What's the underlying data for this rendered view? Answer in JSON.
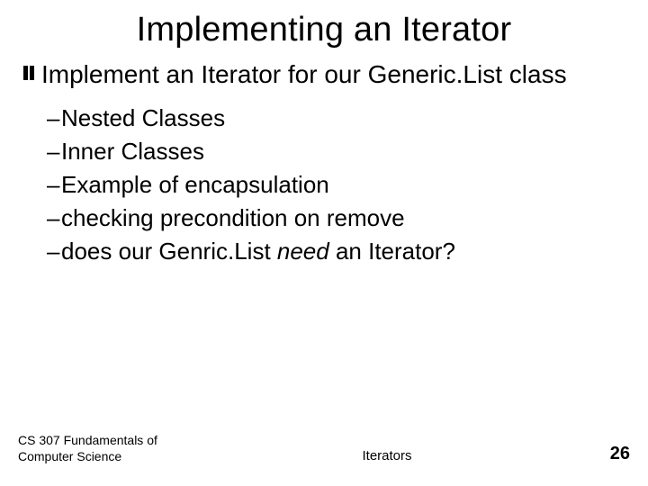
{
  "title": "Implementing an Iterator",
  "main_bullet": "Implement an Iterator for our Generic.List class",
  "sub_bullets": [
    {
      "text": "Nested Classes"
    },
    {
      "text": "Inner Classes"
    },
    {
      "text": "Example of encapsulation"
    },
    {
      "text": "checking precondition on remove"
    },
    {
      "prefix": "does our Genric.List ",
      "emph": "need",
      "suffix": " an Iterator?"
    }
  ],
  "footer": {
    "course": "CS 307 Fundamentals of Computer Science",
    "topic": "Iterators",
    "page": "26"
  }
}
